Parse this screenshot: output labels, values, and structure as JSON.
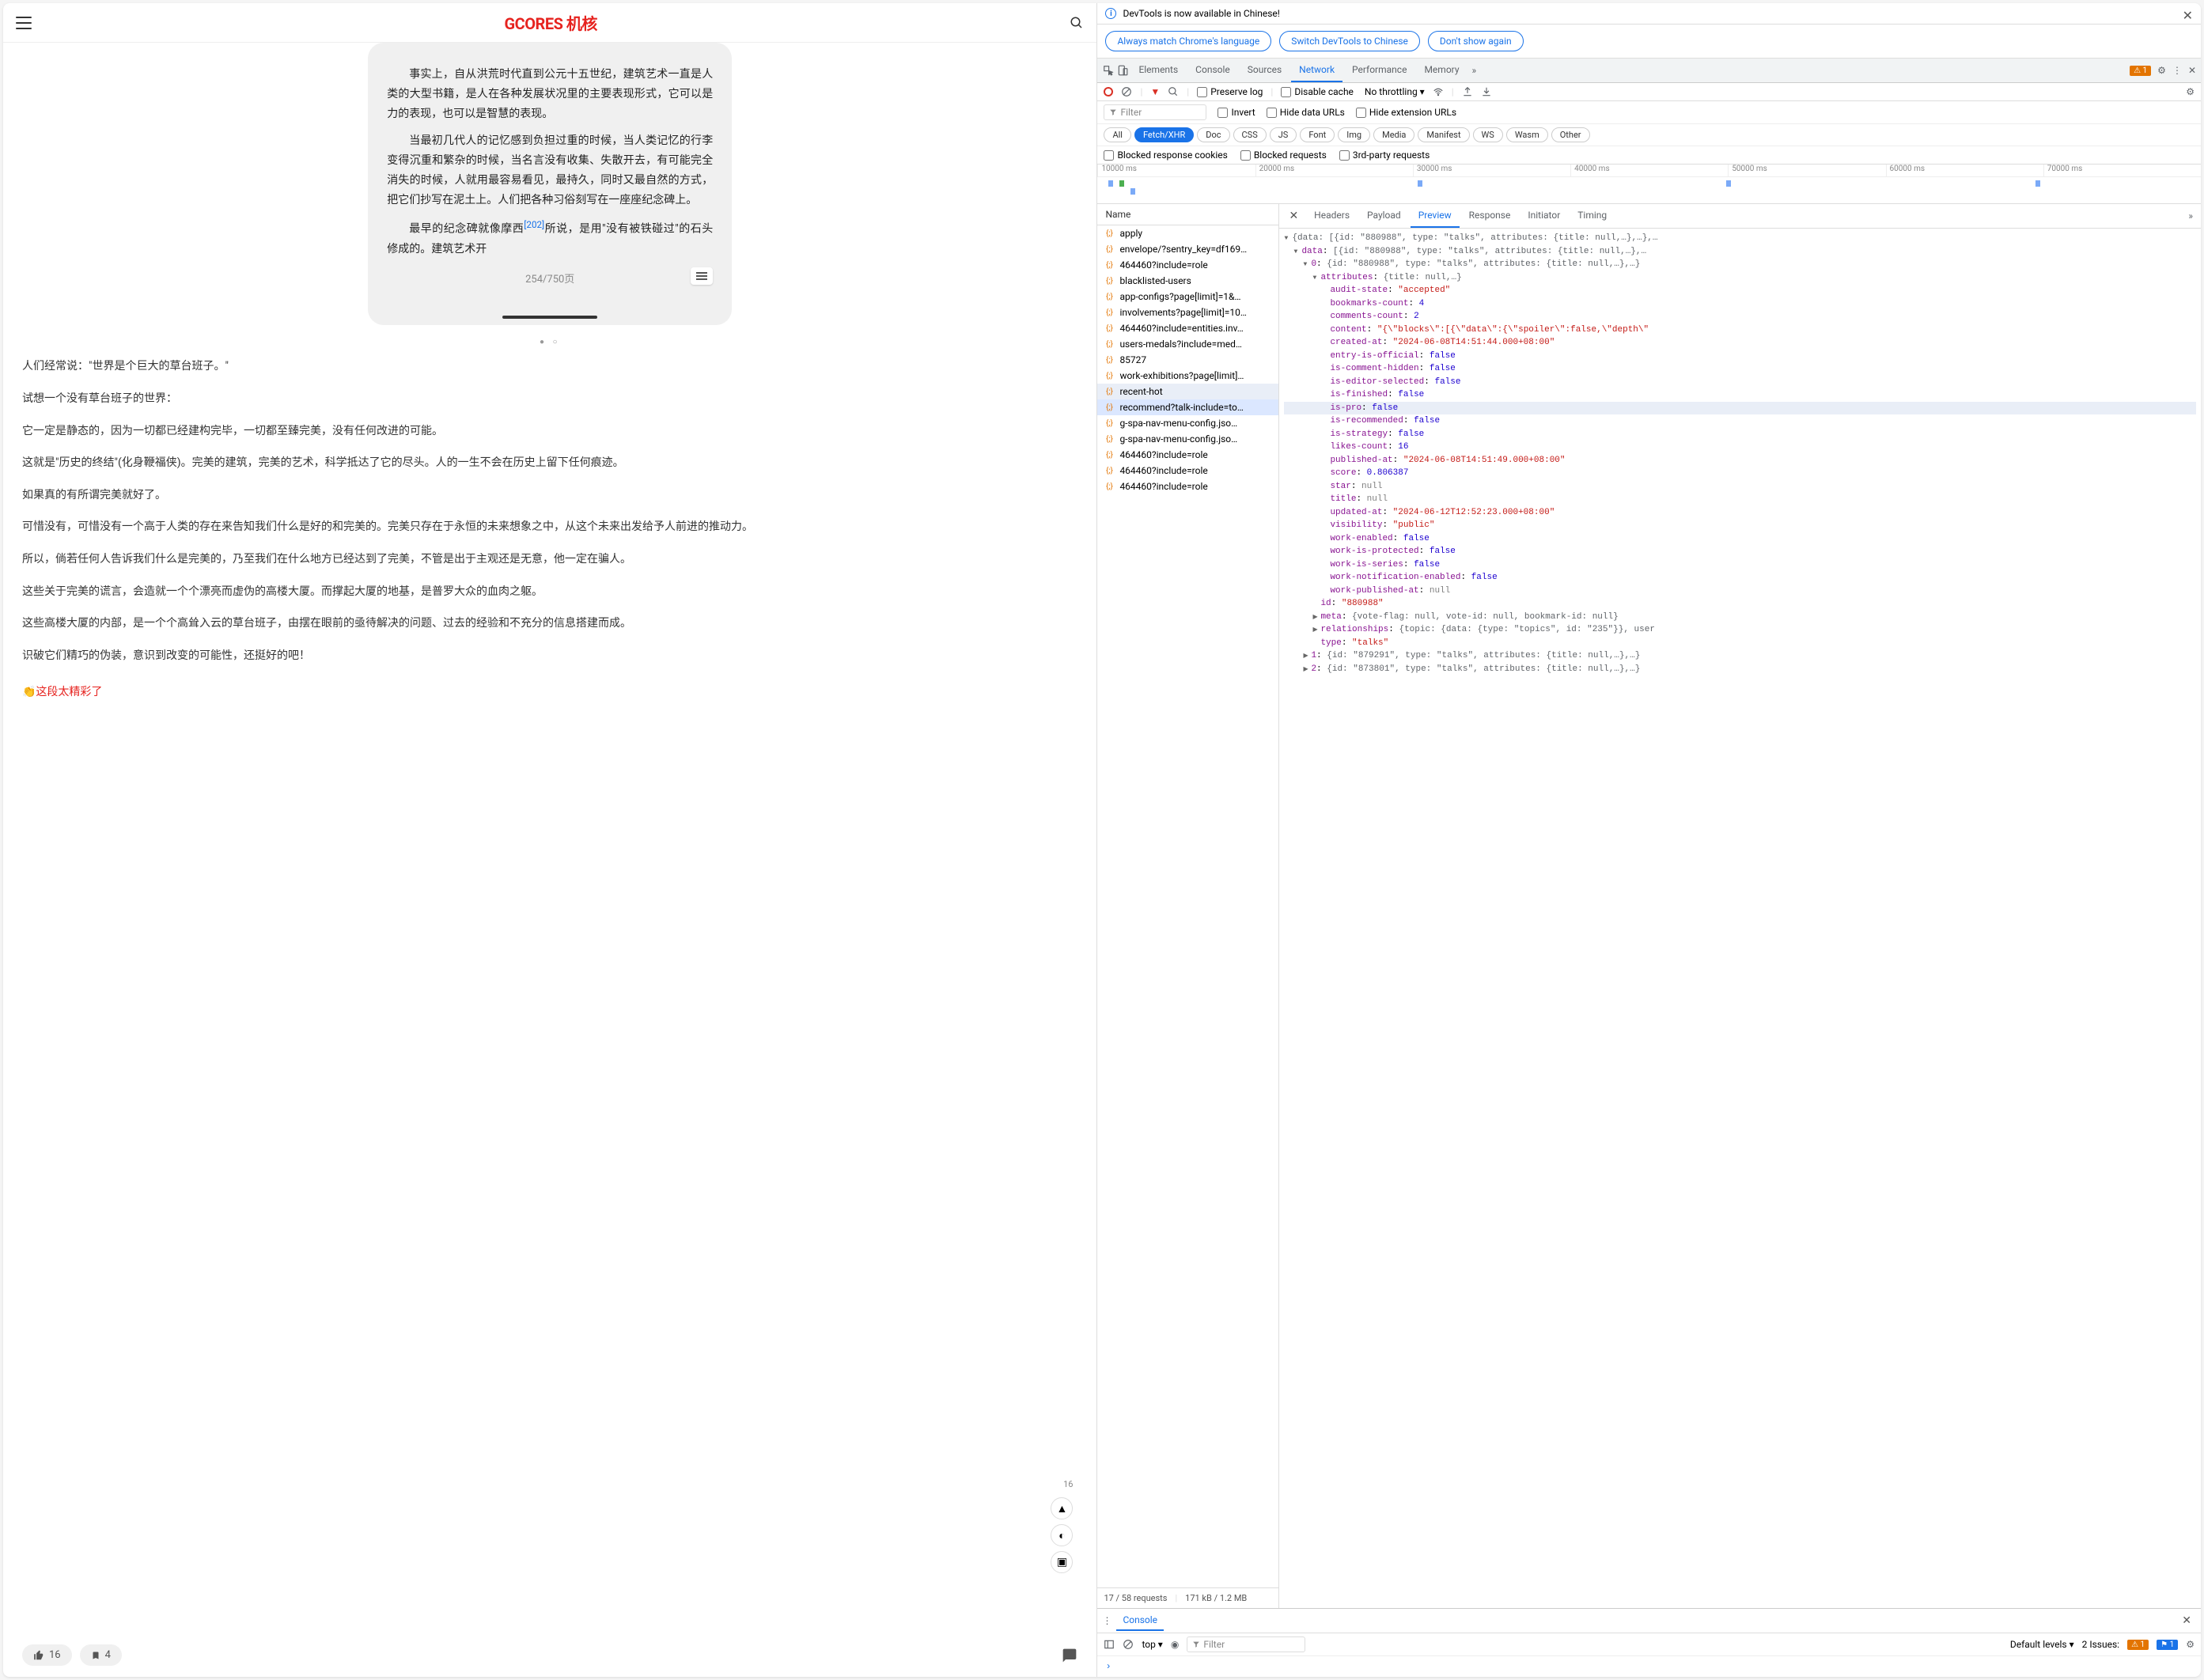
{
  "gcores": {
    "logo": "GCORES 机核",
    "reader": {
      "p1": "事实上，自从洪荒时代直到公元十五世纪，建筑艺术一直是人类的大型书籍，是人在各种发展状况里的主要表现形式，它可以是力的表现，也可以是智慧的表现。",
      "p2": "当最初几代人的记忆感到负担过重的时候，当人类记忆的行李变得沉重和繁杂的时候，当名言没有收集、失散开去，有可能完全消失的时候，人就用最容易看见，最持久，同时又最自然的方式，把它们抄写在泥土上。人们把各种习俗刻写在一座座纪念碑上。",
      "p3a": "最早的纪念碑就像摩西",
      "p3ref": "[202]",
      "p3b": "所说，是用\"没有被铁碰过\"的石头修成的。建筑艺术开",
      "pager": "254/750页"
    },
    "article": {
      "l1": "人们经常说：\"世界是个巨大的草台班子。\"",
      "l2": "试想一个没有草台班子的世界：",
      "l3": "它一定是静态的，因为一切都已经建构完毕，一切都至臻完美，没有任何改进的可能。",
      "l4": "这就是\"历史的终结\"(化身鞭福侠)。完美的建筑，完美的艺术，科学抵达了它的尽头。人的一生不会在历史上留下任何痕迹。",
      "l5": "如果真的有所谓完美就好了。",
      "l6": "可惜没有，可惜没有一个高于人类的存在来告知我们什么是好的和完美的。完美只存在于永恒的未来想象之中，从这个未来出发给予人前进的推动力。",
      "l7": "所以，倘若任何人告诉我们什么是完美的，乃至我们在什么地方已经达到了完美，不管是出于主观还是无意，他一定在骗人。",
      "l8": "这些关于完美的谎言，会造就一个个漂亮而虚伪的高楼大厦。而撑起大厦的地基，是普罗大众的血肉之躯。",
      "l9": "这些高楼大厦的内部，是一个个高耸入云的草台班子，由摆在眼前的亟待解决的问题、过去的经验和不充分的信息搭建而成。",
      "l10": "识破它们精巧的伪装，意识到改变的可能性，还挺好的吧！",
      "highlight": "👏这段太精彩了",
      "count16": "16",
      "likes": "16",
      "bookmarks": "4"
    }
  },
  "devtools": {
    "infobar": "DevTools is now available in Chinese!",
    "langBtns": [
      "Always match Chrome's language",
      "Switch DevTools to Chinese",
      "Don't show again"
    ],
    "tabs": [
      "Elements",
      "Console",
      "Sources",
      "Network",
      "Performance",
      "Memory"
    ],
    "activeTab": "Network",
    "warnCount": "1",
    "toolbar": {
      "preserve": "Preserve log",
      "disableCache": "Disable cache",
      "throttling": "No throttling"
    },
    "filterRow": {
      "filter": "Filter",
      "invert": "Invert",
      "hideData": "Hide data URLs",
      "hideExt": "Hide extension URLs"
    },
    "typeChips": [
      "All",
      "Fetch/XHR",
      "Doc",
      "CSS",
      "JS",
      "Font",
      "Img",
      "Media",
      "Manifest",
      "WS",
      "Wasm",
      "Other"
    ],
    "activeChip": "Fetch/XHR",
    "blockedRow": {
      "cookies": "Blocked response cookies",
      "requests": "Blocked requests",
      "thirdparty": "3rd-party requests"
    },
    "timeline": [
      "10000 ms",
      "20000 ms",
      "30000 ms",
      "40000 ms",
      "50000 ms",
      "60000 ms",
      "70000 ms"
    ],
    "requests": {
      "header": "Name",
      "items": [
        "apply",
        "envelope/?sentry_key=df169…",
        "464460?include=role",
        "blacklisted-users",
        "app-configs?page[limit]=1&…",
        "involvements?page[limit]=10…",
        "464460?include=entities.inv…",
        "users-medals?include=med…",
        "85727",
        "work-exhibitions?page[limit]…",
        "recent-hot",
        "recommend?talk-include=to…",
        "g-spa-nav-menu-config.jso…",
        "g-spa-nav-menu-config.jso…",
        "464460?include=role",
        "464460?include=role",
        "464460?include=role"
      ],
      "selectedIndex": 11,
      "hoverIndex": 10,
      "footer1": "17 / 58 requests",
      "footer2": "171 kB / 1.2 MB"
    },
    "detailTabs": [
      "Headers",
      "Payload",
      "Preview",
      "Response",
      "Initiator",
      "Timing"
    ],
    "activeDetailTab": "Preview",
    "json": {
      "root": "{data: [{id: \"880988\", type: \"talks\", attributes: {title: null,…},…},…",
      "data": "data: [{id: \"880988\", type: \"talks\", attributes: {title: null,…},…",
      "item0": "0: {id: \"880988\", type: \"talks\", attributes: {title: null,…},…}",
      "attrs": "attributes: {title: null,…}",
      "fields": [
        {
          "k": "audit-state",
          "v": "\"accepted\"",
          "t": "str"
        },
        {
          "k": "bookmarks-count",
          "v": "4",
          "t": "num"
        },
        {
          "k": "comments-count",
          "v": "2",
          "t": "num"
        },
        {
          "k": "content",
          "v": "\"{\\\"blocks\\\":[{\\\"data\\\":{\\\"spoiler\\\":false,\\\"depth\\\"",
          "t": "str"
        },
        {
          "k": "created-at",
          "v": "\"2024-06-08T14:51:44.000+08:00\"",
          "t": "str"
        },
        {
          "k": "entry-is-official",
          "v": "false",
          "t": "bool"
        },
        {
          "k": "is-comment-hidden",
          "v": "false",
          "t": "bool"
        },
        {
          "k": "is-editor-selected",
          "v": "false",
          "t": "bool"
        },
        {
          "k": "is-finished",
          "v": "false",
          "t": "bool"
        },
        {
          "k": "is-pro",
          "v": "false",
          "t": "bool",
          "hl": true
        },
        {
          "k": "is-recommended",
          "v": "false",
          "t": "bool"
        },
        {
          "k": "is-strategy",
          "v": "false",
          "t": "bool"
        },
        {
          "k": "likes-count",
          "v": "16",
          "t": "num"
        },
        {
          "k": "published-at",
          "v": "\"2024-06-08T14:51:49.000+08:00\"",
          "t": "str"
        },
        {
          "k": "score",
          "v": "0.806387",
          "t": "num"
        },
        {
          "k": "star",
          "v": "null",
          "t": "null"
        },
        {
          "k": "title",
          "v": "null",
          "t": "null"
        },
        {
          "k": "updated-at",
          "v": "\"2024-06-12T12:52:23.000+08:00\"",
          "t": "str"
        },
        {
          "k": "visibility",
          "v": "\"public\"",
          "t": "str"
        },
        {
          "k": "work-enabled",
          "v": "false",
          "t": "bool"
        },
        {
          "k": "work-is-protected",
          "v": "false",
          "t": "bool"
        },
        {
          "k": "work-is-series",
          "v": "false",
          "t": "bool"
        },
        {
          "k": "work-notification-enabled",
          "v": "false",
          "t": "bool"
        },
        {
          "k": "work-published-at",
          "v": "null",
          "t": "null"
        }
      ],
      "id": "id: \"880988\"",
      "meta": "meta: {vote-flag: null, vote-id: null, bookmark-id: null}",
      "rel": "relationships: {topic: {data: {type: \"topics\", id: \"235\"}}, user",
      "type": "type: \"talks\"",
      "item1": "1: {id: \"879291\", type: \"talks\", attributes: {title: null,…},…}",
      "item2": "2: {id: \"873801\", type: \"talks\", attributes: {title: null,…},…}"
    },
    "console": {
      "tab": "Console",
      "top": "top",
      "filter": "Filter",
      "levels": "Default levels",
      "issuesLabel": "2 Issues:",
      "issue1": "1",
      "issue2": "1",
      "prompt": "›"
    }
  }
}
